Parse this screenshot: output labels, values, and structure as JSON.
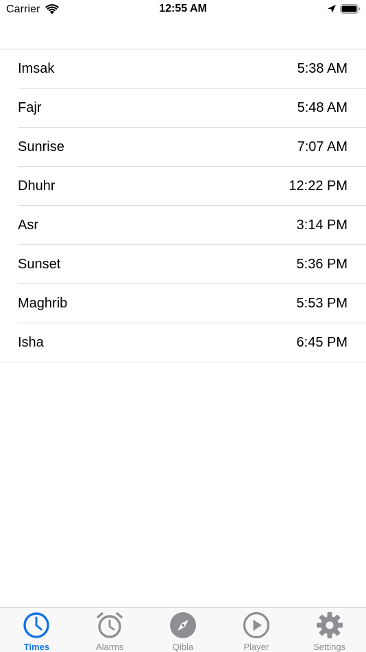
{
  "status_bar": {
    "carrier": "Carrier",
    "time": "12:55 AM",
    "icons": [
      "wifi-icon",
      "location-arrow-icon",
      "battery-icon"
    ]
  },
  "prayer_times": [
    {
      "name": "Imsak",
      "time": "5:38 AM"
    },
    {
      "name": "Fajr",
      "time": "5:48 AM"
    },
    {
      "name": "Sunrise",
      "time": "7:07 AM"
    },
    {
      "name": "Dhuhr",
      "time": "12:22 PM"
    },
    {
      "name": "Asr",
      "time": "3:14 PM"
    },
    {
      "name": "Sunset",
      "time": "5:36 PM"
    },
    {
      "name": "Maghrib",
      "time": "5:53 PM"
    },
    {
      "name": "Isha",
      "time": "6:45 PM"
    }
  ],
  "tab_bar": {
    "active_color": "#1473e6",
    "inactive_color": "#8e8e93",
    "tabs": [
      {
        "label": "Times",
        "icon": "clock-icon",
        "active": true
      },
      {
        "label": "Alarms",
        "icon": "alarm-clock-icon",
        "active": false
      },
      {
        "label": "Qibla",
        "icon": "compass-icon",
        "active": false
      },
      {
        "label": "Player",
        "icon": "play-circle-icon",
        "active": false
      },
      {
        "label": "Settings",
        "icon": "gear-icon",
        "active": false
      }
    ]
  }
}
